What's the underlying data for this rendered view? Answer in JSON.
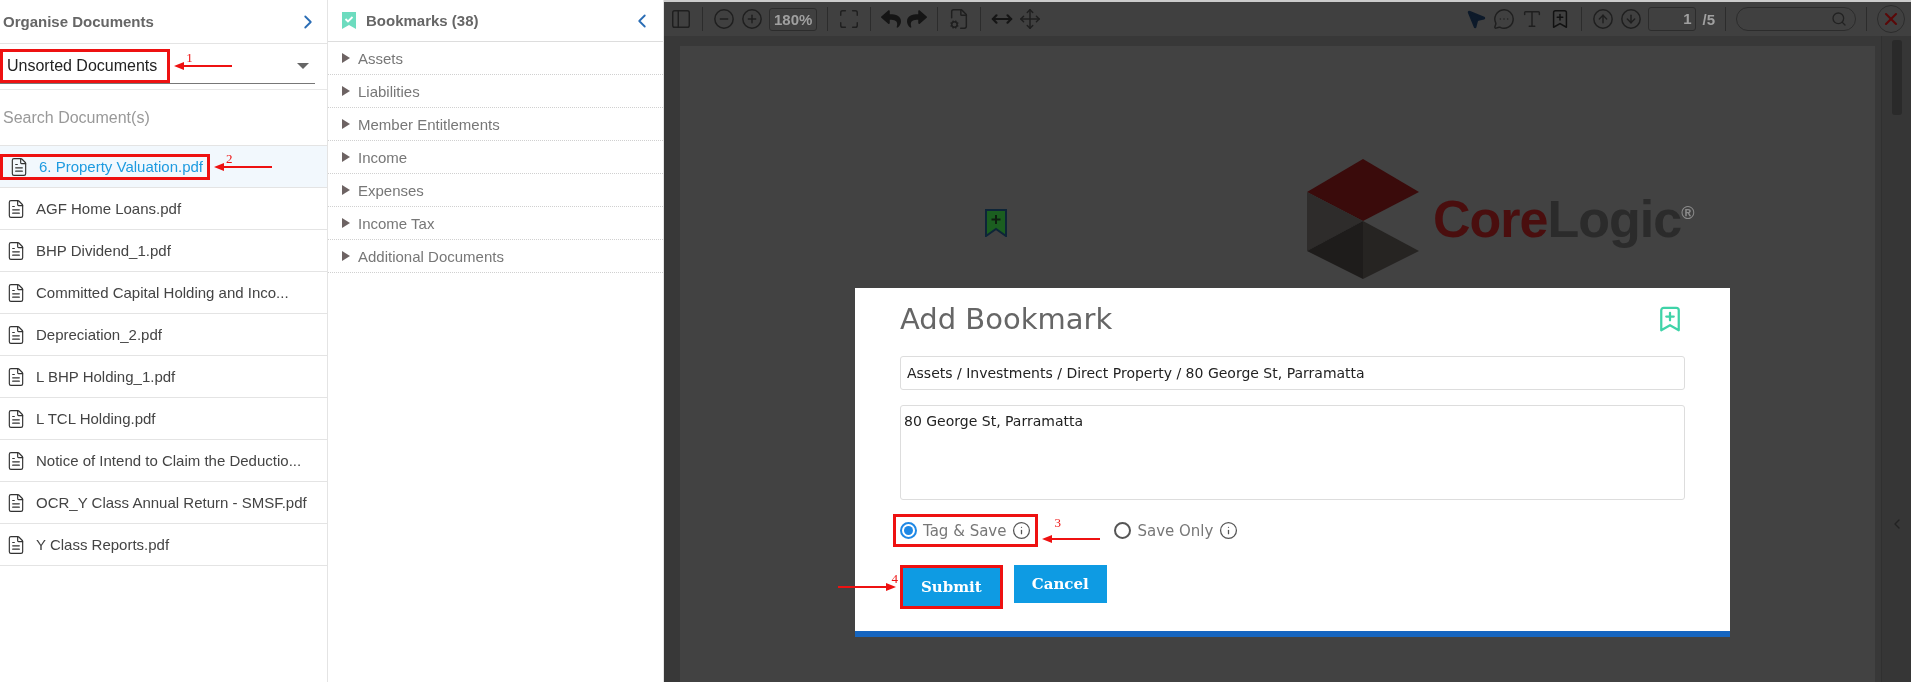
{
  "organise_panel": {
    "title": "Organise Documents",
    "folder_select": {
      "value": "Unsorted Documents",
      "callout": {
        "number": "1"
      }
    },
    "search": {
      "placeholder": "Search Document(s)"
    },
    "documents": [
      {
        "name": "6. Property Valuation.pdf",
        "selected": true,
        "callout": {
          "number": "2"
        }
      },
      {
        "name": "AGF Home Loans.pdf",
        "selected": false
      },
      {
        "name": "BHP Dividend_1.pdf",
        "selected": false
      },
      {
        "name": "Committed Capital Holding and Inco...",
        "selected": false
      },
      {
        "name": "Depreciation_2.pdf",
        "selected": false
      },
      {
        "name": "L BHP Holding_1.pdf",
        "selected": false
      },
      {
        "name": "L TCL Holding.pdf",
        "selected": false
      },
      {
        "name": "Notice of Intend to Claim the Deductio...",
        "selected": false
      },
      {
        "name": "OCR_Y Class Annual Return - SMSF.pdf",
        "selected": false
      },
      {
        "name": "Y Class Reports.pdf",
        "selected": false
      }
    ]
  },
  "bookmarks_panel": {
    "title": "Bookmarks (38)",
    "items": [
      {
        "label": "Assets",
        "expanded": false
      },
      {
        "label": "Liabilities",
        "expanded": false
      },
      {
        "label": "Member Entitlements",
        "expanded": false
      },
      {
        "label": "Income",
        "expanded": false
      },
      {
        "label": "Expenses",
        "expanded": false
      },
      {
        "label": "Income Tax",
        "expanded": false
      },
      {
        "label": "Additional Documents",
        "expanded": false
      }
    ]
  },
  "viewer": {
    "toolbar": {
      "zoom": "180%",
      "page": "1",
      "page_total": "/5"
    },
    "document": {
      "logo_parts": [
        "Core",
        "Logic"
      ],
      "logo_mark": "®"
    }
  },
  "dialog": {
    "title": "Add Bookmark",
    "path": "Assets / Investments / Direct Property / 80 George St, Parramatta",
    "description": "80 George St, Parramatta",
    "options": [
      {
        "label": "Tag & Save",
        "selected": true,
        "callout": {
          "number": "3"
        }
      },
      {
        "label": "Save Only",
        "selected": false
      }
    ],
    "buttons": [
      {
        "label": "Submit",
        "kind": "primary",
        "callout": {
          "number": "4"
        }
      },
      {
        "label": "Cancel",
        "kind": "primary"
      }
    ]
  }
}
